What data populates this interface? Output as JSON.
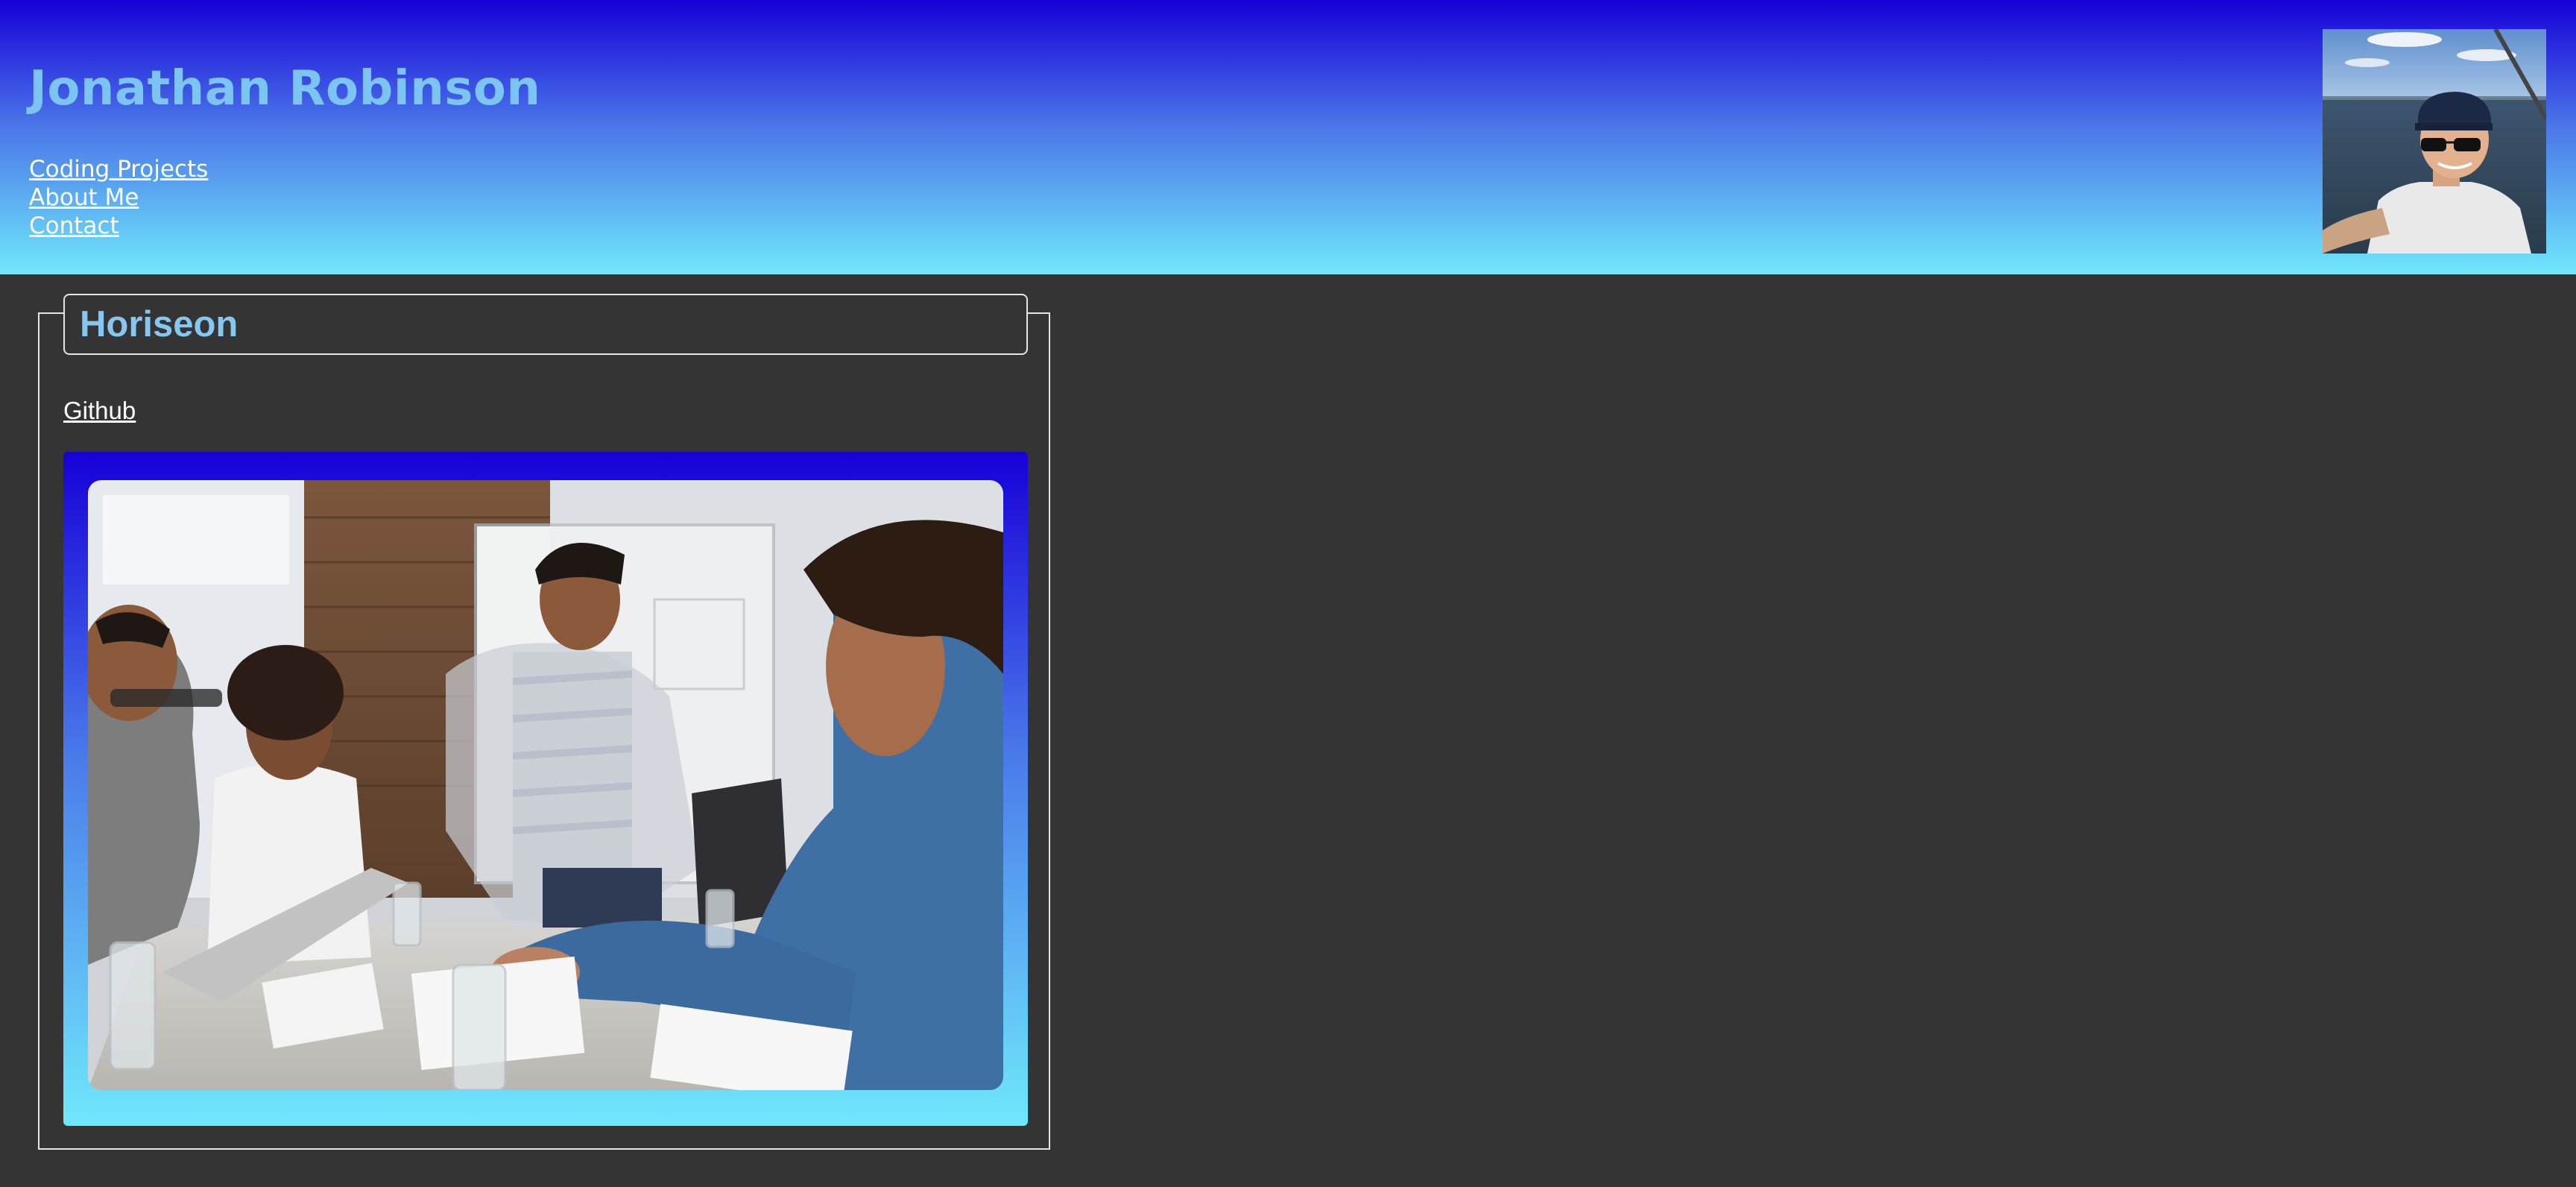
{
  "header": {
    "title": "Jonathan Robinson",
    "nav": [
      {
        "label": "Coding Projects"
      },
      {
        "label": "About Me"
      },
      {
        "label": "Contact"
      }
    ]
  },
  "project": {
    "title": "Horiseon",
    "github_label": "Github"
  },
  "colors": {
    "header_gradient_top": "#1600d8",
    "header_gradient_bottom": "#6fe8fb",
    "title_color": "#7bc4f4",
    "page_background": "#343434",
    "link_color": "#ffffff"
  }
}
